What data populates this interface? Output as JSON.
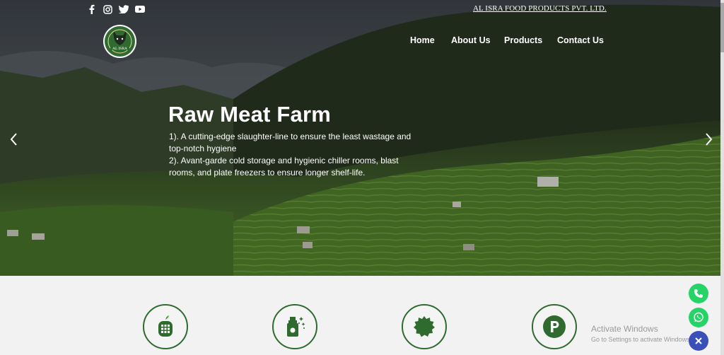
{
  "brand": {
    "name": "AL ISRA FOOD PRODUCTS PVT. LTD.",
    "logo_text": "AL ISRA"
  },
  "social": [
    "facebook-icon",
    "instagram-icon",
    "twitter-icon",
    "youtube-icon"
  ],
  "nav": {
    "items": [
      "Home",
      "About Us",
      "Products",
      "Contact Us"
    ]
  },
  "slide": {
    "title": "Raw Meat Farm",
    "lines": [
      "1). A cutting-edge slaughter-line to ensure the least wastage and top-notch hygiene",
      "2). Avant-garde cold storage and hygienic chiller rooms, blast rooms, and plate freezers to ensure longer shelf-life."
    ]
  },
  "features": [
    "apple-calculator-icon",
    "spray-bottle-icon",
    "badge-icon",
    "parking-icon"
  ],
  "watermark": {
    "title": "Activate Windows",
    "subtitle": "Go to Settings to activate Windows."
  },
  "colors": {
    "accent_green": "#2f6b2f",
    "whatsapp": "#25d366",
    "close": "#3b4fb8"
  }
}
